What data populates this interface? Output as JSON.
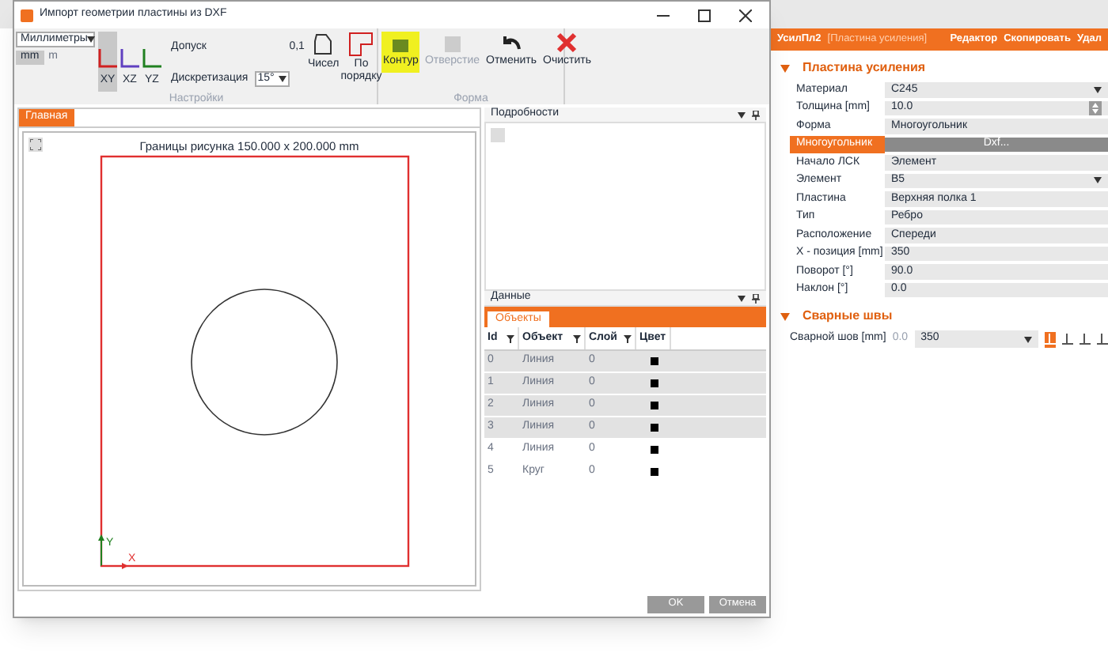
{
  "dialog": {
    "title": "Импорт геометрии пластины из DXF",
    "units": {
      "value": "Миллиметры",
      "options": [
        {
          "label": "mm",
          "selected": true
        },
        {
          "label": "m",
          "selected": false
        }
      ]
    },
    "planes": [
      {
        "label": "XY",
        "selected": true
      },
      {
        "label": "XZ",
        "selected": false
      },
      {
        "label": "YZ",
        "selected": false
      }
    ],
    "tolerance": {
      "label": "Допуск",
      "value": "0,1"
    },
    "discretization": {
      "label": "Дискретизация",
      "value": "15°"
    },
    "settings_buttons": [
      {
        "label": "Чисел"
      },
      {
        "label": "По порядку"
      }
    ],
    "settings_group": "Настройки",
    "form_buttons": [
      {
        "label": "Контур",
        "kind": "contour",
        "highlighted": true,
        "disabled": false
      },
      {
        "label": "Отверстие",
        "kind": "hole",
        "highlighted": false,
        "disabled": true
      },
      {
        "label": "Отменить",
        "kind": "undo",
        "highlighted": false,
        "disabled": false
      },
      {
        "label": "Очистить",
        "kind": "clear",
        "highlighted": false,
        "disabled": false
      }
    ],
    "form_group": "Форма",
    "main_tab": "Главная",
    "canvas_caption": "Границы рисунка 150.000 x 200.000 mm",
    "axis_labels": [
      "Y",
      "X"
    ],
    "details_title": "Подробности",
    "data_title": "Данные",
    "data_tab": "Объекты",
    "table": {
      "columns": [
        "Id",
        "Объект",
        "Слой",
        "Цвет"
      ],
      "rows": [
        {
          "id": "0",
          "object": "Линия",
          "layer": "0",
          "selected": true
        },
        {
          "id": "1",
          "object": "Линия",
          "layer": "0",
          "selected": true
        },
        {
          "id": "2",
          "object": "Линия",
          "layer": "0",
          "selected": true
        },
        {
          "id": "3",
          "object": "Линия",
          "layer": "0",
          "selected": true
        },
        {
          "id": "4",
          "object": "Линия",
          "layer": "0",
          "selected": false
        },
        {
          "id": "5",
          "object": "Круг",
          "layer": "0",
          "selected": false
        }
      ]
    },
    "buttons": [
      "OK",
      "Отмена"
    ]
  },
  "panel": {
    "name": "УсилПл2",
    "type": "[Пластина усиления]",
    "actions": [
      "Редактор",
      "Скопировать",
      "Удал"
    ],
    "sections": [
      {
        "title": "Пластина усиления",
        "expanded": true,
        "rows": [
          {
            "label": "Материал",
            "value": "C245",
            "kind": "dropdown",
            "selected": false
          },
          {
            "label": "Толщина [mm]",
            "value": "10.0",
            "kind": "spin",
            "selected": false
          },
          {
            "label": "Форма",
            "value": "Многоугольник",
            "kind": "text",
            "selected": false
          },
          {
            "label": "Многоугольник",
            "value": "Dxf...",
            "kind": "button",
            "selected": true
          },
          {
            "label": "Начало ЛСК",
            "value": "Элемент",
            "kind": "text",
            "selected": false
          },
          {
            "label": "Элемент",
            "value": "B5",
            "kind": "dropdown",
            "selected": false
          },
          {
            "label": "Пластина",
            "value": "Верхняя полка 1",
            "kind": "text",
            "selected": false
          },
          {
            "label": "Тип",
            "value": "Ребро",
            "kind": "text",
            "selected": false
          },
          {
            "label": "Расположение",
            "value": "Спереди",
            "kind": "text",
            "selected": false
          },
          {
            "label": "X - позиция [mm]",
            "value": "350",
            "kind": "text",
            "selected": false
          },
          {
            "label": "Поворот [°]",
            "value": "90.0",
            "kind": "text",
            "selected": false
          },
          {
            "label": "Наклон [°]",
            "value": "0.0",
            "kind": "text",
            "selected": false
          }
        ]
      },
      {
        "title": "Сварные швы",
        "expanded": true,
        "weld": {
          "label": "Сварной шов [mm]",
          "size": "0.0",
          "value": "350"
        }
      }
    ]
  }
}
